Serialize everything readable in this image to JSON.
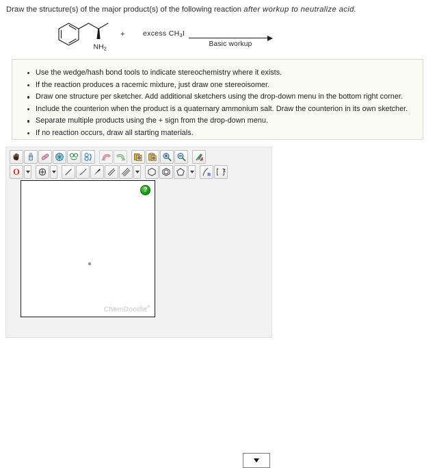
{
  "prompt": {
    "lead": "Draw the structure(s) of the major product(s) of the following reaction ",
    "emphasis": "after workup to neutralize acid."
  },
  "reaction": {
    "reactant_name": "amphetamine-structure",
    "reactant_label": "NH",
    "reactant_label_sub": "2",
    "plus": "+",
    "reagent_prefix": "excess  CH",
    "reagent_sub": "3",
    "reagent_suffix": "I",
    "arrow_label": "Basic workup"
  },
  "instructions": {
    "items": [
      "Use the wedge/hash bond tools to indicate stereochemistry where it exists.",
      "If the reaction produces a racemic mixture, just draw one stereoisomer.",
      "Draw one structure per sketcher. Add additional sketchers using the drop-down menu in the bottom right corner.",
      "Include the counterion when the product is a quaternary ammonium salt. Draw the counterion in its own sketcher.",
      "Separate multiple products using the + sign from the drop-down menu.",
      "If no reaction occurs, draw all starting materials."
    ]
  },
  "sketcher": {
    "toolbar_row1": [
      {
        "name": "hand-pan-icon",
        "title": "Pan"
      },
      {
        "name": "lasso-select-icon",
        "title": "Lasso Select"
      },
      {
        "name": "eraser-icon",
        "title": "Erase"
      },
      {
        "name": "move-transform-icon",
        "title": "Move"
      },
      {
        "name": "flip-horizontal-icon",
        "title": "Flip Horizontal"
      },
      {
        "name": "rotate-icon",
        "title": "Rotate"
      },
      {
        "name": "undo-icon",
        "title": "Undo"
      },
      {
        "name": "redo-icon",
        "title": "Redo"
      },
      {
        "name": "copy-icon",
        "title": "Copy"
      },
      {
        "name": "paste-icon",
        "title": "Paste"
      },
      {
        "name": "zoom-in-icon",
        "title": "Zoom In"
      },
      {
        "name": "zoom-out-icon",
        "title": "Zoom Out"
      },
      {
        "name": "clear-icon",
        "title": "Clear"
      }
    ],
    "toolbar_row2": [
      {
        "name": "atom-label-oxygen-button",
        "label": "O"
      },
      {
        "name": "charge-tool-icon",
        "title": "Charge"
      },
      {
        "name": "single-bond-icon",
        "title": "Single Bond"
      },
      {
        "name": "hash-bond-icon",
        "title": "Hash Bond"
      },
      {
        "name": "wedge-bond-icon",
        "title": "Wedge Bond"
      },
      {
        "name": "double-bond-icon",
        "title": "Double Bond"
      },
      {
        "name": "triple-bond-icon",
        "title": "Triple Bond"
      },
      {
        "name": "cyclohexane-ring-icon",
        "title": "Cyclohexane"
      },
      {
        "name": "benzene-ring-icon",
        "title": "Benzene"
      },
      {
        "name": "cyclopentane-ring-icon",
        "title": "Cyclopentane"
      },
      {
        "name": "polymer-repeat-icon",
        "label": "n"
      },
      {
        "name": "bracket-charge-icon",
        "label": "±"
      }
    ],
    "help_button_label": "?",
    "watermark": "ChemDoodle",
    "watermark_mark": "®",
    "sketcher_select_value": ""
  },
  "colors": {
    "panel_bg": "#fbfbf6",
    "panel_border": "#d8d8d0",
    "sketcher_bg": "#f2f2f2",
    "help_green": "#18a016",
    "atom_oxygen_red": "#e02b20",
    "watermark_gray": "#c9c9c9"
  }
}
